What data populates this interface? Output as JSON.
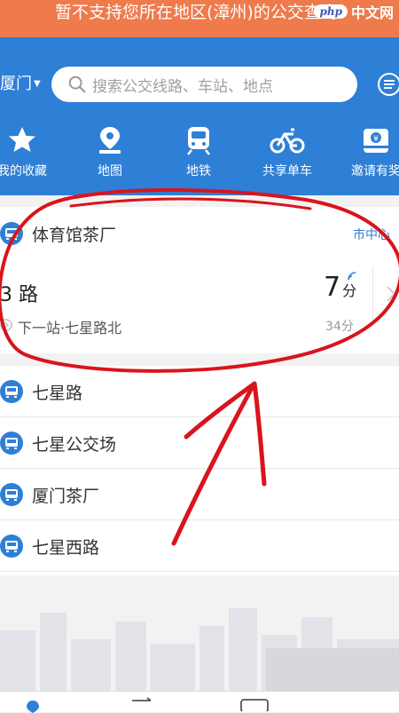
{
  "banner": {
    "text": "暂不支持您所在地区(漳州)的公交查询"
  },
  "watermark": {
    "logo": "php",
    "text": "中文网"
  },
  "header": {
    "city": "厦门",
    "search_placeholder": "搜索公交线路、车站、地点"
  },
  "shortcuts": [
    {
      "label": "我的收藏",
      "icon": "star-icon"
    },
    {
      "label": "地图",
      "icon": "map-pin-icon"
    },
    {
      "label": "地铁",
      "icon": "metro-icon"
    },
    {
      "label": "共享单车",
      "icon": "bicycle-icon"
    },
    {
      "label": "邀请有奖",
      "icon": "gift-card-icon"
    }
  ],
  "card": {
    "stop_name": "体育馆茶厂",
    "area": "市中心",
    "route": "3 路",
    "next_stop": "下一站·七星路北",
    "eta_value": "7",
    "eta_unit": "分",
    "eta_next": "34分"
  },
  "stops": [
    {
      "name": "七星路"
    },
    {
      "name": "七星公交场"
    },
    {
      "name": "厦门茶厂"
    },
    {
      "name": "七星西路"
    }
  ],
  "colors": {
    "primary": "#2e7fd6",
    "banner": "#ef7a4b",
    "annotation": "#d9141c"
  }
}
